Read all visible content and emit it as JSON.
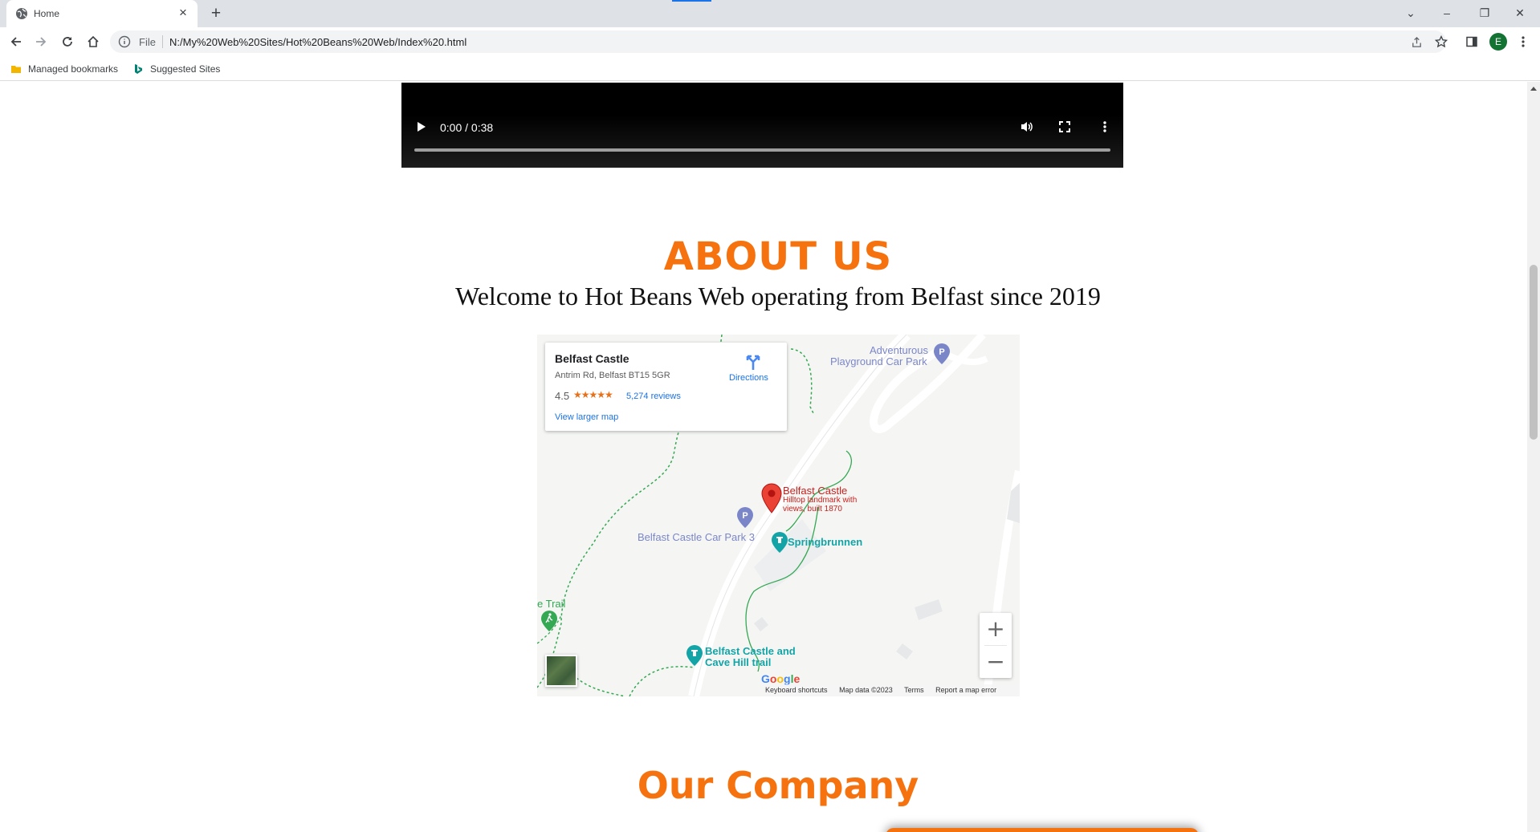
{
  "browser": {
    "tab_title": "Home",
    "new_tab_label": "+",
    "tab_close_label": "×",
    "scheme_label": "File",
    "url": "N:/My%20Web%20Sites/Hot%20Beans%20Web/Index%20.html",
    "profile_initial": "E",
    "window_controls": {
      "list": "⌄",
      "minimize": "–",
      "restore": "❐",
      "close": "✕"
    }
  },
  "bookmarks": [
    {
      "label": "Managed bookmarks",
      "icon": "folder-icon"
    },
    {
      "label": "Suggested Sites",
      "icon": "bing-icon"
    }
  ],
  "video": {
    "time": "0:00 / 0:38",
    "progress": 0
  },
  "about": {
    "heading": "ABOUT US",
    "subheading": "Welcome to Hot Beans Web operating from Belfast since 2019"
  },
  "map": {
    "place_name": "Belfast Castle",
    "address": "Antrim Rd, Belfast BT15 5GR",
    "rating": "4.5",
    "stars": "★★★★★",
    "reviews": "5,274 reviews",
    "view_larger": "View larger map",
    "directions": "Directions",
    "labels": {
      "adventurous": "Adventurous",
      "playground": "Playground Car Park",
      "castle": "Belfast Castle",
      "castle_desc1": "Hilltop landmark with",
      "castle_desc2": "views, built 1870",
      "car_park": "Belfast Castle Car Park 3",
      "springbrunnen": "Springbrunnen",
      "trail": "e Trail",
      "cave_hill1": "Belfast Castle and",
      "cave_hill2": "Cave Hill trail"
    },
    "zoom_in": "+",
    "zoom_out": "−",
    "attribution": {
      "shortcuts": "Keyboard shortcuts",
      "map_data": "Map data ©2023",
      "terms": "Terms",
      "report": "Report a map error"
    },
    "colors": {
      "pin": "#ea4335",
      "park_pin": "#7b86c9",
      "attraction": "#12a4a6",
      "trail": "#34a853",
      "label_blue": "#7b86c9"
    }
  },
  "company": {
    "heading": "Our Company"
  },
  "colors": {
    "accent": "#f5720f"
  }
}
